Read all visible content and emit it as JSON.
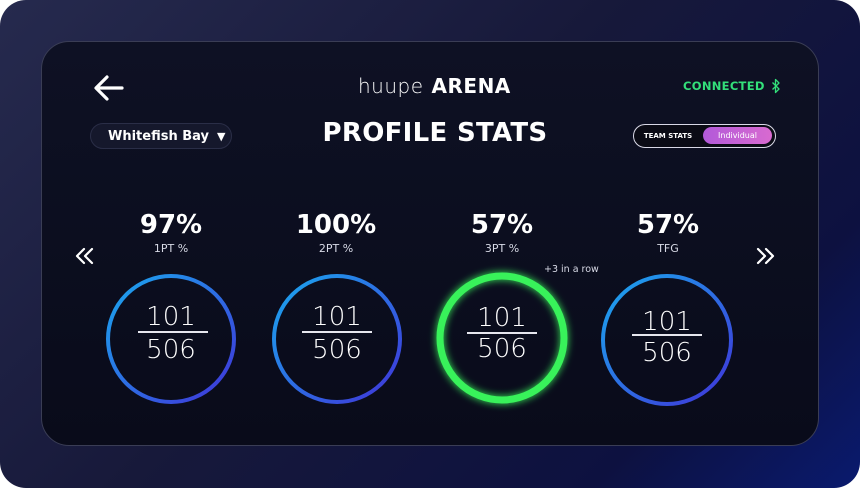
{
  "header": {
    "brand_light": "huupe",
    "brand_bold": "ARENA",
    "status": "CONNECTED",
    "status_color": "#33e07a"
  },
  "filters": {
    "location": "Whitefish Bay",
    "toggle_team": "TEAM STATS",
    "toggle_individual": "Individual",
    "toggle_selected": "Individual"
  },
  "page_title": "PROFILE STATS",
  "stats": [
    {
      "pct": "97%",
      "label": "1PT %",
      "made": "101",
      "attempts": "506",
      "highlight": false
    },
    {
      "pct": "100%",
      "label": "2PT %",
      "made": "101",
      "attempts": "506",
      "highlight": false
    },
    {
      "pct": "57%",
      "label": "3PT %",
      "made": "101",
      "attempts": "506",
      "highlight": true,
      "note": "+3 in a row"
    },
    {
      "pct": "57%",
      "label": "TFG",
      "made": "101",
      "attempts": "506",
      "highlight": false
    }
  ],
  "colors": {
    "ring_gradient_start": "#1aa8ee",
    "ring_gradient_end": "#4033d8",
    "highlight_ring": "#39f25a",
    "accent_pink": "#c862d6"
  },
  "icons": {
    "back": "back-arrow-icon",
    "bluetooth": "bluetooth-icon",
    "prev": "double-chevron-left-icon",
    "next": "double-chevron-right-icon",
    "caret": "caret-down-icon"
  }
}
